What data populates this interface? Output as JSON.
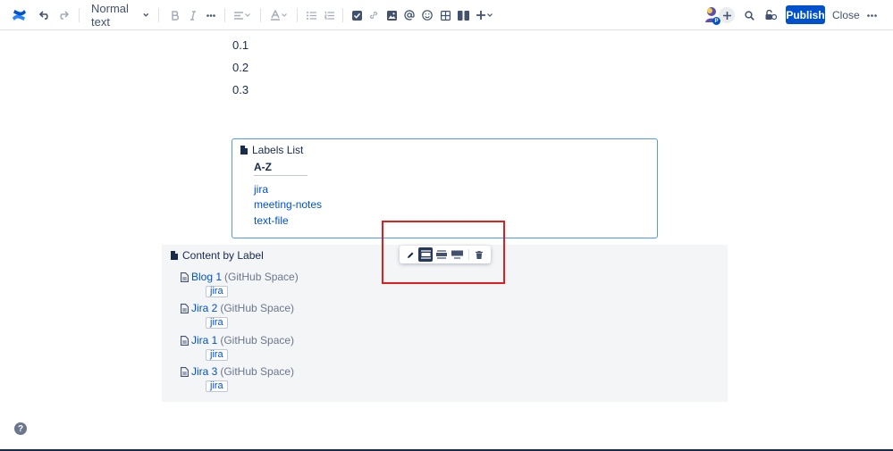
{
  "toolbar": {
    "text_style": "Normal text",
    "publish_label": "Publish",
    "close_label": "Close",
    "avatar_badge": "P"
  },
  "body_paragraphs": [
    "0.1",
    "0.2",
    "0.3"
  ],
  "labels_list": {
    "title": "Labels List",
    "heading": "A-Z",
    "labels": [
      "jira",
      "meeting-notes",
      "text-file"
    ]
  },
  "content_by_label": {
    "title": "Content by Label",
    "results": [
      {
        "title": "Blog 1",
        "space": "(GitHub Space)",
        "tag": "jira"
      },
      {
        "title": "Jira 2",
        "space": "(GitHub Space)",
        "tag": "jira"
      },
      {
        "title": "Jira 1",
        "space": "(GitHub Space)",
        "tag": "jira"
      },
      {
        "title": "Jira 3",
        "space": "(GitHub Space)",
        "tag": "jira"
      }
    ]
  },
  "help_glyph": "?",
  "colors": {
    "accent": "#0052cc",
    "macro_border": "#4c9aff",
    "highlight_box": "#e01e1e",
    "macro_background": "#f4f5f7"
  }
}
